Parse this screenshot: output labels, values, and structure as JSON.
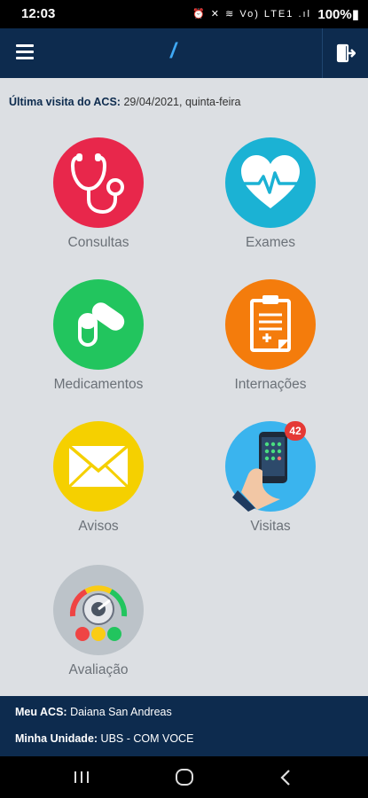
{
  "status_bar": {
    "time": "12:03",
    "icons": "⏰ ✕ ≋ Vo) LTE1 .ıl",
    "battery": "100%▮"
  },
  "app_bar": {
    "title": "/",
    "menu_icon": "hamburger-menu-icon",
    "logout_icon": "logout-icon"
  },
  "last_visit": {
    "label": "Última visita do ACS:",
    "value": "29/04/2021, quinta-feira"
  },
  "tiles": [
    {
      "label": "Consultas",
      "color": "#e8274b",
      "icon": "stethoscope-icon"
    },
    {
      "label": "Exames",
      "color": "#1bb2d4",
      "icon": "heartbeat-icon"
    },
    {
      "label": "Medicamentos",
      "color": "#22c55e",
      "icon": "pills-icon"
    },
    {
      "label": "Internações",
      "color": "#f47c0c",
      "icon": "clipboard-icon"
    },
    {
      "label": "Avisos",
      "color": "#f5d000",
      "icon": "envelope-icon"
    },
    {
      "label": "Visitas",
      "color": "#3ab4ee",
      "icon": "phone-in-hand-icon",
      "badge": "42"
    },
    {
      "label": "Avaliação",
      "color": "#bcc3c9",
      "icon": "gauge-icon"
    }
  ],
  "footer": {
    "acs_label": "Meu ACS:",
    "acs_value": "Daiana San Andreas",
    "unit_label": "Minha Unidade:",
    "unit_value": "UBS - COM VOCE"
  },
  "nav_bar": {
    "recents_icon": "recents-icon",
    "home_icon": "home-icon",
    "back_icon": "back-icon"
  }
}
